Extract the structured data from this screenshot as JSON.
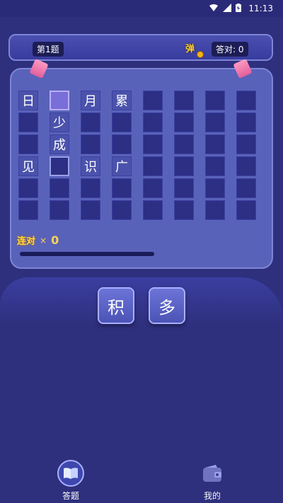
{
  "status": {
    "time": "11:13"
  },
  "header": {
    "level": "第1题",
    "ball_label": "弹",
    "answers": "答对: 0"
  },
  "grid": {
    "rows": [
      [
        "日",
        "",
        "月",
        "累",
        "",
        "",
        "",
        ""
      ],
      [
        "",
        "少",
        "",
        "",
        "",
        "",
        "",
        ""
      ],
      [
        "",
        "成",
        "",
        "",
        "",
        "",
        "",
        ""
      ],
      [
        "见",
        "",
        "识",
        "广",
        "",
        "",
        "",
        ""
      ],
      [
        "",
        "",
        "",
        "",
        "",
        "",
        "",
        ""
      ],
      [
        "",
        "",
        "",
        "",
        "",
        "",
        "",
        ""
      ]
    ]
  },
  "combo": {
    "label": "连对",
    "times": "×",
    "count": "0"
  },
  "choices": [
    "积",
    "多"
  ],
  "tabs": [
    {
      "label": "答题",
      "active": true,
      "icon": "book-icon"
    },
    {
      "label": "我的",
      "active": false,
      "icon": "wallet-icon"
    }
  ],
  "colors": {
    "background": "#2e2f7d",
    "board": "#5962b9",
    "cell": "#2c2f83",
    "accent": "#ffd451"
  }
}
